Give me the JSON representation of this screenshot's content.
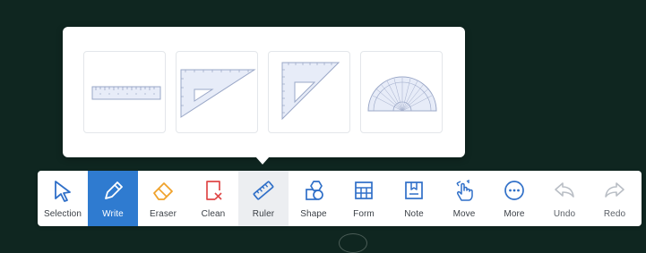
{
  "colors": {
    "board_background": "#0f2620",
    "accent_active": "#2f7bd0",
    "icon_blue": "#2f6fc8",
    "icon_orange": "#f0a22b",
    "icon_red": "#e04848",
    "icon_disabled": "#b9bec5"
  },
  "ruler_popup": {
    "tools": [
      {
        "name": "straight-ruler",
        "icon": "straight-ruler-icon"
      },
      {
        "name": "set-square-30-60",
        "icon": "set-square-30-60-icon"
      },
      {
        "name": "set-square-45",
        "icon": "set-square-45-icon"
      },
      {
        "name": "protractor",
        "icon": "protractor-icon"
      }
    ]
  },
  "toolbar": {
    "items": [
      {
        "label": "Selection",
        "icon": "cursor-arrow-icon",
        "state": "normal"
      },
      {
        "label": "Write",
        "icon": "pen-icon",
        "state": "active"
      },
      {
        "label": "Eraser",
        "icon": "eraser-icon",
        "state": "normal"
      },
      {
        "label": "Clean",
        "icon": "clean-page-icon",
        "state": "normal"
      },
      {
        "label": "Ruler",
        "icon": "ruler-icon",
        "state": "highlight"
      },
      {
        "label": "Shape",
        "icon": "shapes-icon",
        "state": "normal"
      },
      {
        "label": "Form",
        "icon": "table-grid-icon",
        "state": "normal"
      },
      {
        "label": "Note",
        "icon": "note-icon",
        "state": "normal"
      },
      {
        "label": "Move",
        "icon": "hand-move-icon",
        "state": "normal"
      },
      {
        "label": "More",
        "icon": "more-dots-icon",
        "state": "normal"
      },
      {
        "label": "Undo",
        "icon": "undo-icon",
        "state": "disabled"
      },
      {
        "label": "Redo",
        "icon": "redo-icon",
        "state": "disabled"
      }
    ]
  }
}
